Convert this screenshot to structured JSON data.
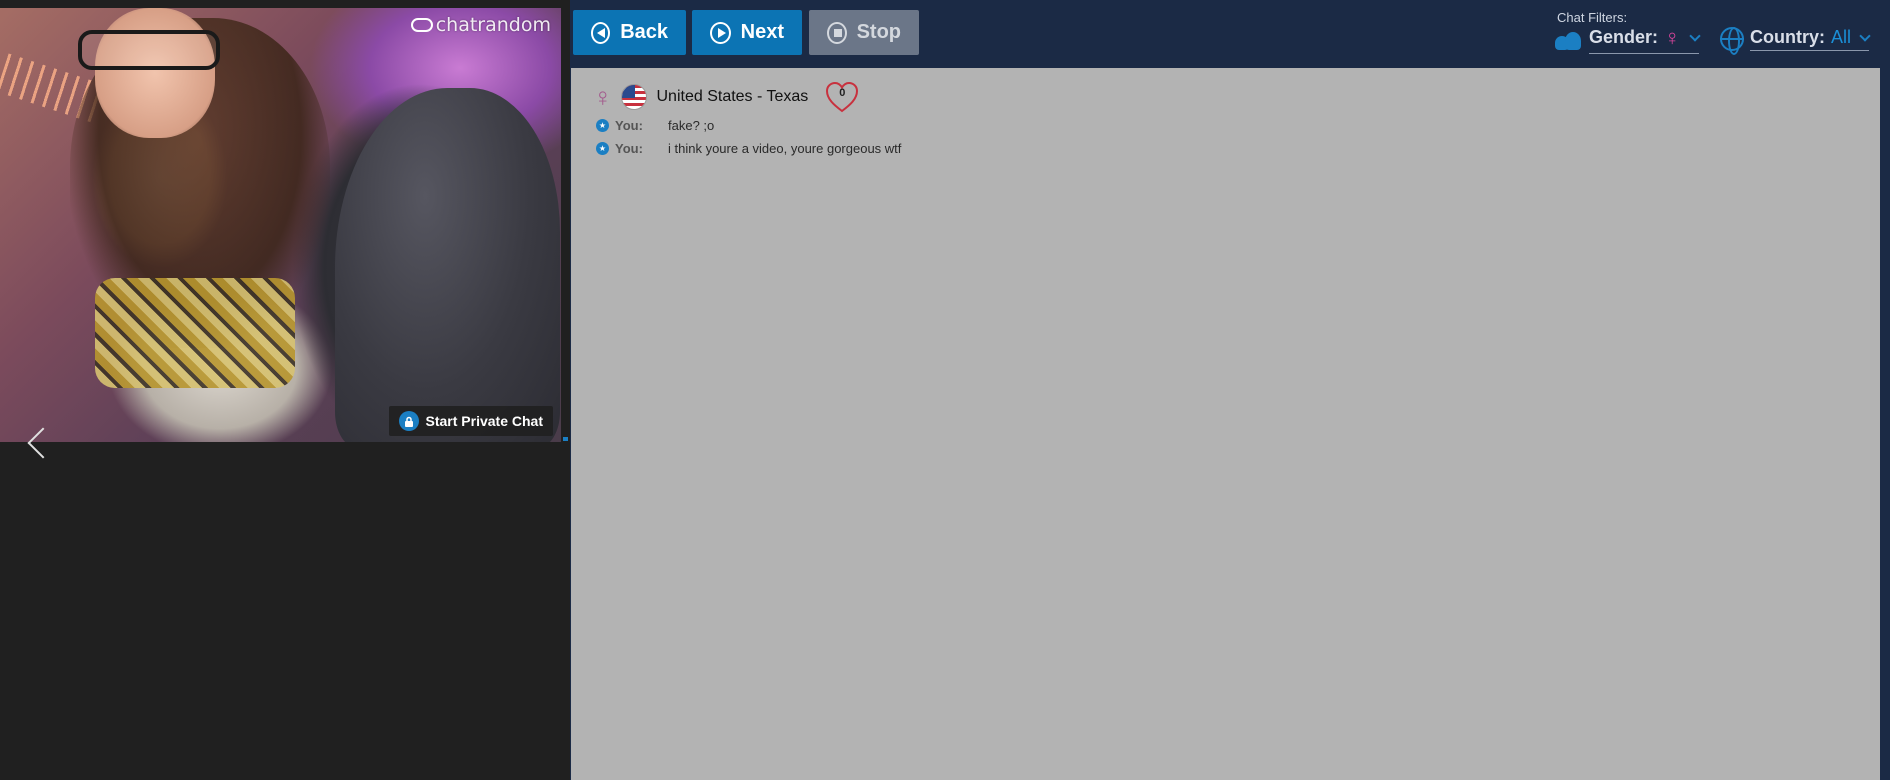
{
  "video": {
    "watermark": "chatrandom",
    "private_chat_label": "Start Private Chat"
  },
  "controls": {
    "back_label": "Back",
    "next_label": "Next",
    "stop_label": "Stop"
  },
  "filters": {
    "title": "Chat Filters:",
    "gender_label": "Gender:",
    "gender_value": "♀",
    "country_label": "Country:",
    "country_value": "All"
  },
  "chat": {
    "partner_gender": "♀",
    "partner_location": "United States - Texas",
    "likes": "0",
    "messages": [
      {
        "sender": "You:",
        "text": "fake? ;o"
      },
      {
        "sender": "You:",
        "text": "i think youre a video, youre gorgeous wtf"
      }
    ]
  },
  "colors": {
    "accent": "#0c74b4",
    "header_bg": "#1b2a45",
    "chat_bg": "#b3b3b3",
    "female": "#d9459c"
  }
}
